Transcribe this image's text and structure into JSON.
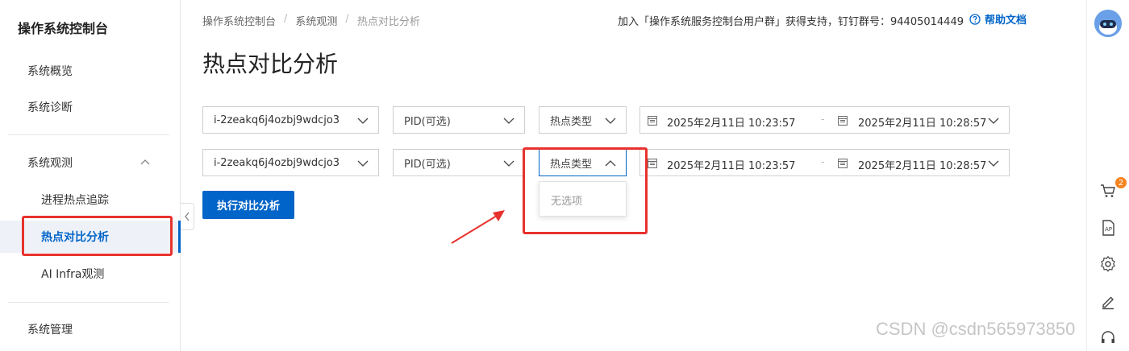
{
  "sidebar": {
    "title": "操作系统控制台",
    "items": {
      "overview": "系统概览",
      "diagnosis": "系统诊断",
      "observe": "系统观测",
      "process_hotspot": "进程热点追踪",
      "hotspot_compare": "热点对比分析",
      "ai_infra": "AI Infra观测",
      "manage": "系统管理"
    }
  },
  "breadcrumb": [
    "操作系统控制台",
    "系统观测",
    "热点对比分析"
  ],
  "header": {
    "notice": "加入「操作系统服务控制台用户群」获得支持，钉钉群号：94405014449",
    "help_label": "帮助文档"
  },
  "page_title": "热点对比分析",
  "rows": [
    {
      "instance": "i-2zeakq6j4ozbj9wdcjo3",
      "pid_placeholder": "PID(可选)",
      "hotspot_type_placeholder": "热点类型",
      "start_time": "2025年2月11日 10:23:57",
      "end_time": "2025年2月11日 10:28:57",
      "date_sep": "-"
    },
    {
      "instance": "i-2zeakq6j4ozbj9wdcjo3",
      "pid_placeholder": "PID(可选)",
      "hotspot_type_placeholder": "热点类型",
      "start_time": "2025年2月11日 10:23:57",
      "end_time": "2025年2月11日 10:28:57",
      "date_sep": "-"
    }
  ],
  "dropdown": {
    "empty_text": "无选项"
  },
  "run_button": "执行对比分析",
  "rail": {
    "cart_badge": "2"
  },
  "watermark": "CSDN @csdn565973850",
  "colors": {
    "accent": "#0064c8",
    "highlight": "#e8322d",
    "badge": "#f5831f"
  }
}
